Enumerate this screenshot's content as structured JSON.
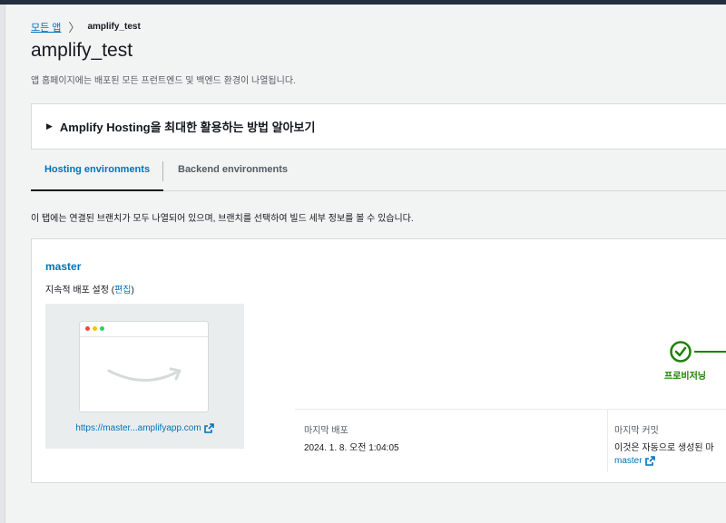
{
  "breadcrumb": {
    "root": "모든 앱",
    "separator": "〉",
    "current": "amplify_test"
  },
  "page": {
    "title": "amplify_test",
    "subtitle": "앱 홈페이지에는 배포된 모든 프런트엔드 및 백엔드 환경이 나열됩니다."
  },
  "expander": {
    "label": "Amplify Hosting을 최대한 활용하는 방법 알아보기"
  },
  "tabs": [
    {
      "label": "Hosting environments",
      "active": true
    },
    {
      "label": "Backend environments",
      "active": false
    }
  ],
  "description": "이 탭에는 연결된 브랜치가 모두 나열되어 있으며, 브랜치를 선택하여 빌드 세부 정보를 볼 수 있습니다.",
  "branch_card": {
    "name": "master",
    "cd_text": "지속적 배포 설정 (",
    "cd_edit": "편집",
    "cd_close": ")",
    "url": "https://master...amplifyapp.com",
    "status": "프로비저닝",
    "last_deploy_label": "마지막 배포",
    "last_deploy_value": "2024. 1. 8. 오전 1:04:05",
    "last_commit_label": "마지막 커밋",
    "last_commit_value": "이것은 자동으로 생성된 마",
    "commit_branch": "master"
  },
  "colors": {
    "link": "#0073bb",
    "success": "#1d8102",
    "topbar": "#232f3e"
  },
  "icons": [
    "external-link-icon",
    "check-circle-icon",
    "amazon-smile-icon",
    "caret-right-icon"
  ]
}
